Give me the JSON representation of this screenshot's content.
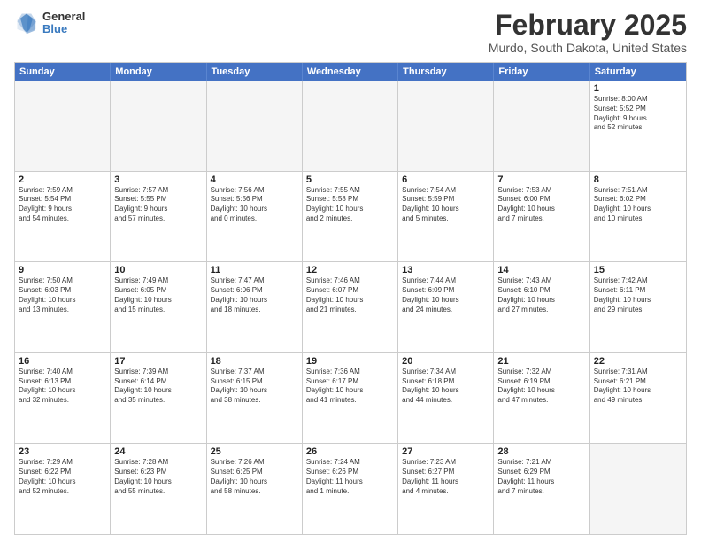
{
  "header": {
    "logo": {
      "general": "General",
      "blue": "Blue"
    },
    "title": "February 2025",
    "location": "Murdo, South Dakota, United States"
  },
  "days_of_week": [
    "Sunday",
    "Monday",
    "Tuesday",
    "Wednesday",
    "Thursday",
    "Friday",
    "Saturday"
  ],
  "weeks": [
    [
      {
        "day": "",
        "empty": true,
        "text": ""
      },
      {
        "day": "",
        "empty": true,
        "text": ""
      },
      {
        "day": "",
        "empty": true,
        "text": ""
      },
      {
        "day": "",
        "empty": true,
        "text": ""
      },
      {
        "day": "",
        "empty": true,
        "text": ""
      },
      {
        "day": "",
        "empty": true,
        "text": ""
      },
      {
        "day": "1",
        "empty": false,
        "text": "Sunrise: 8:00 AM\nSunset: 5:52 PM\nDaylight: 9 hours\nand 52 minutes."
      }
    ],
    [
      {
        "day": "2",
        "empty": false,
        "text": "Sunrise: 7:59 AM\nSunset: 5:54 PM\nDaylight: 9 hours\nand 54 minutes."
      },
      {
        "day": "3",
        "empty": false,
        "text": "Sunrise: 7:57 AM\nSunset: 5:55 PM\nDaylight: 9 hours\nand 57 minutes."
      },
      {
        "day": "4",
        "empty": false,
        "text": "Sunrise: 7:56 AM\nSunset: 5:56 PM\nDaylight: 10 hours\nand 0 minutes."
      },
      {
        "day": "5",
        "empty": false,
        "text": "Sunrise: 7:55 AM\nSunset: 5:58 PM\nDaylight: 10 hours\nand 2 minutes."
      },
      {
        "day": "6",
        "empty": false,
        "text": "Sunrise: 7:54 AM\nSunset: 5:59 PM\nDaylight: 10 hours\nand 5 minutes."
      },
      {
        "day": "7",
        "empty": false,
        "text": "Sunrise: 7:53 AM\nSunset: 6:00 PM\nDaylight: 10 hours\nand 7 minutes."
      },
      {
        "day": "8",
        "empty": false,
        "text": "Sunrise: 7:51 AM\nSunset: 6:02 PM\nDaylight: 10 hours\nand 10 minutes."
      }
    ],
    [
      {
        "day": "9",
        "empty": false,
        "text": "Sunrise: 7:50 AM\nSunset: 6:03 PM\nDaylight: 10 hours\nand 13 minutes."
      },
      {
        "day": "10",
        "empty": false,
        "text": "Sunrise: 7:49 AM\nSunset: 6:05 PM\nDaylight: 10 hours\nand 15 minutes."
      },
      {
        "day": "11",
        "empty": false,
        "text": "Sunrise: 7:47 AM\nSunset: 6:06 PM\nDaylight: 10 hours\nand 18 minutes."
      },
      {
        "day": "12",
        "empty": false,
        "text": "Sunrise: 7:46 AM\nSunset: 6:07 PM\nDaylight: 10 hours\nand 21 minutes."
      },
      {
        "day": "13",
        "empty": false,
        "text": "Sunrise: 7:44 AM\nSunset: 6:09 PM\nDaylight: 10 hours\nand 24 minutes."
      },
      {
        "day": "14",
        "empty": false,
        "text": "Sunrise: 7:43 AM\nSunset: 6:10 PM\nDaylight: 10 hours\nand 27 minutes."
      },
      {
        "day": "15",
        "empty": false,
        "text": "Sunrise: 7:42 AM\nSunset: 6:11 PM\nDaylight: 10 hours\nand 29 minutes."
      }
    ],
    [
      {
        "day": "16",
        "empty": false,
        "text": "Sunrise: 7:40 AM\nSunset: 6:13 PM\nDaylight: 10 hours\nand 32 minutes."
      },
      {
        "day": "17",
        "empty": false,
        "text": "Sunrise: 7:39 AM\nSunset: 6:14 PM\nDaylight: 10 hours\nand 35 minutes."
      },
      {
        "day": "18",
        "empty": false,
        "text": "Sunrise: 7:37 AM\nSunset: 6:15 PM\nDaylight: 10 hours\nand 38 minutes."
      },
      {
        "day": "19",
        "empty": false,
        "text": "Sunrise: 7:36 AM\nSunset: 6:17 PM\nDaylight: 10 hours\nand 41 minutes."
      },
      {
        "day": "20",
        "empty": false,
        "text": "Sunrise: 7:34 AM\nSunset: 6:18 PM\nDaylight: 10 hours\nand 44 minutes."
      },
      {
        "day": "21",
        "empty": false,
        "text": "Sunrise: 7:32 AM\nSunset: 6:19 PM\nDaylight: 10 hours\nand 47 minutes."
      },
      {
        "day": "22",
        "empty": false,
        "text": "Sunrise: 7:31 AM\nSunset: 6:21 PM\nDaylight: 10 hours\nand 49 minutes."
      }
    ],
    [
      {
        "day": "23",
        "empty": false,
        "text": "Sunrise: 7:29 AM\nSunset: 6:22 PM\nDaylight: 10 hours\nand 52 minutes."
      },
      {
        "day": "24",
        "empty": false,
        "text": "Sunrise: 7:28 AM\nSunset: 6:23 PM\nDaylight: 10 hours\nand 55 minutes."
      },
      {
        "day": "25",
        "empty": false,
        "text": "Sunrise: 7:26 AM\nSunset: 6:25 PM\nDaylight: 10 hours\nand 58 minutes."
      },
      {
        "day": "26",
        "empty": false,
        "text": "Sunrise: 7:24 AM\nSunset: 6:26 PM\nDaylight: 11 hours\nand 1 minute."
      },
      {
        "day": "27",
        "empty": false,
        "text": "Sunrise: 7:23 AM\nSunset: 6:27 PM\nDaylight: 11 hours\nand 4 minutes."
      },
      {
        "day": "28",
        "empty": false,
        "text": "Sunrise: 7:21 AM\nSunset: 6:29 PM\nDaylight: 11 hours\nand 7 minutes."
      },
      {
        "day": "",
        "empty": true,
        "text": ""
      }
    ]
  ]
}
